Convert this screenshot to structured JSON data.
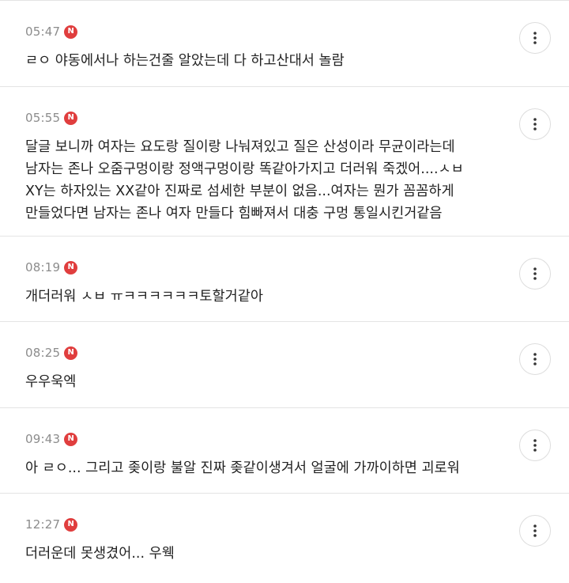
{
  "comments": [
    {
      "time": "05:47",
      "badge": "N",
      "text": "ㄹㅇ 야동에서나 하는건줄 알았는데 다 하고산대서 놀람"
    },
    {
      "time": "05:55",
      "badge": "N",
      "text": "달글 보니까 여자는 요도랑 질이랑 나눠져있고 질은 산성이라 무균이라는데\n남자는 존나 오줌구멍이랑 정액구멍이랑 똑같아가지고 더러워 죽겠어....ㅅㅂ\nXY는 하자있는 XX같아 진짜로 섬세한 부분이 없음...여자는 뭔가 꼼꼼하게\n만들었다면 남자는 존나 여자 만들다 힘빠져서 대충 구멍 통일시킨거같음"
    },
    {
      "time": "08:19",
      "badge": "N",
      "text": "개더러워 ㅅㅂ ㅠㅋㅋㅋㅋㅋㅋ토할거같아"
    },
    {
      "time": "08:25",
      "badge": "N",
      "text": "우우욱엑"
    },
    {
      "time": "09:43",
      "badge": "N",
      "text": "아 ㄹㅇ... 그리고 좆이랑 불알 진짜 좆같이생겨서 얼굴에 가까이하면 괴로워"
    },
    {
      "time": "12:27",
      "badge": "N",
      "text": "더러운데 못생겼어... 우웩"
    }
  ],
  "icons": {
    "new_badge": "new-badge-icon",
    "more": "more-vertical-icon"
  },
  "colors": {
    "badge": "#e03e3e",
    "time": "#8c8c8c",
    "text": "#222222",
    "divider": "#e4e4e4"
  }
}
